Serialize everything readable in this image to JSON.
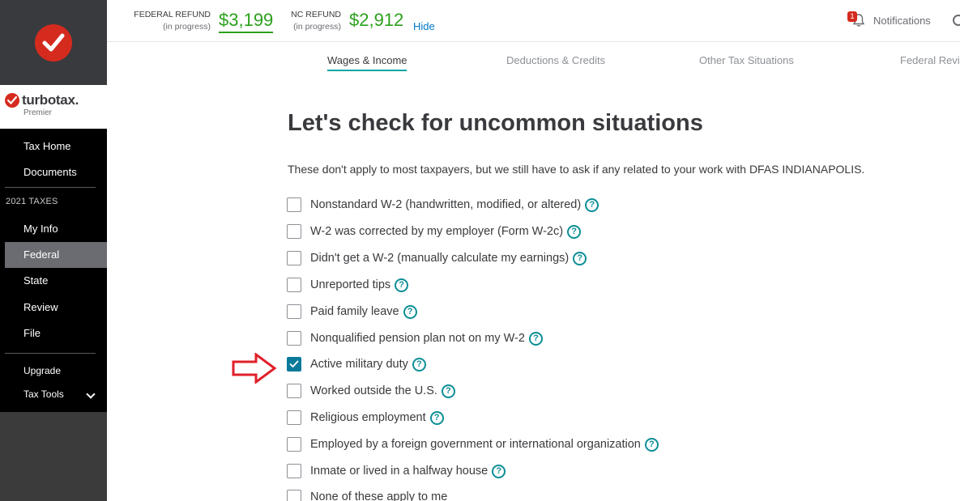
{
  "sidebar": {
    "brand_name": "turbotax.",
    "brand_edition": "Premier",
    "items": [
      {
        "label": "Tax Home"
      },
      {
        "label": "Documents"
      },
      {
        "label": "My Info"
      },
      {
        "label": "Federal"
      },
      {
        "label": "State"
      },
      {
        "label": "Review"
      },
      {
        "label": "File"
      }
    ],
    "section_label": "2021 TAXES",
    "upgrade_label": "Upgrade",
    "tools_label": "Tax Tools",
    "active_item": "Federal"
  },
  "header": {
    "federal": {
      "label": "FEDERAL REFUND",
      "sub": "(in progress)",
      "amount": "$3,199"
    },
    "nc": {
      "label": "NC REFUND",
      "sub": "(in progress)",
      "amount": "$2,912"
    },
    "hide_label": "Hide",
    "notifications_label": "Notifications",
    "notifications_count": "1"
  },
  "tabs": [
    {
      "label": "Wages & Income",
      "active": true
    },
    {
      "label": "Deductions & Credits",
      "active": false
    },
    {
      "label": "Other Tax Situations",
      "active": false
    },
    {
      "label": "Federal Revi",
      "active": false
    }
  ],
  "main": {
    "title": "Let's check for uncommon situations",
    "intro": "These don't apply to most taxpayers, but we still have to ask if any related to your work with DFAS INDIANAPOLIS.",
    "help_glyph": "?",
    "options": [
      {
        "label": "Nonstandard W-2 (handwritten, modified, or altered)",
        "checked": false
      },
      {
        "label": "W-2 was corrected by my employer (Form W-2c)",
        "checked": false
      },
      {
        "label": "Didn't get a W-2 (manually calculate my earnings)",
        "checked": false
      },
      {
        "label": "Unreported tips",
        "checked": false
      },
      {
        "label": "Paid family leave",
        "checked": false
      },
      {
        "label": "Nonqualified pension plan not on my W-2",
        "checked": false
      },
      {
        "label": "Active military duty",
        "checked": true
      },
      {
        "label": "Worked outside the U.S.",
        "checked": false
      },
      {
        "label": "Religious employment",
        "checked": false
      },
      {
        "label": "Employed by a foreign government or international organization",
        "checked": false
      },
      {
        "label": "Inmate or lived in a halfway house",
        "checked": false
      },
      {
        "label": "None of these apply to me",
        "checked": false
      }
    ]
  },
  "colors": {
    "brand_red": "#d52b1e",
    "refund_green": "#2ca01c",
    "link_blue": "#0077c5",
    "teal": "#0a7a9a",
    "annotation_arrow": "#e0202a"
  },
  "icons": {
    "logo": "turbotax-check-icon",
    "notifications": "bell-icon",
    "search": "search-icon",
    "help": "help-circle-icon",
    "annotation": "red-arrow-icon"
  }
}
